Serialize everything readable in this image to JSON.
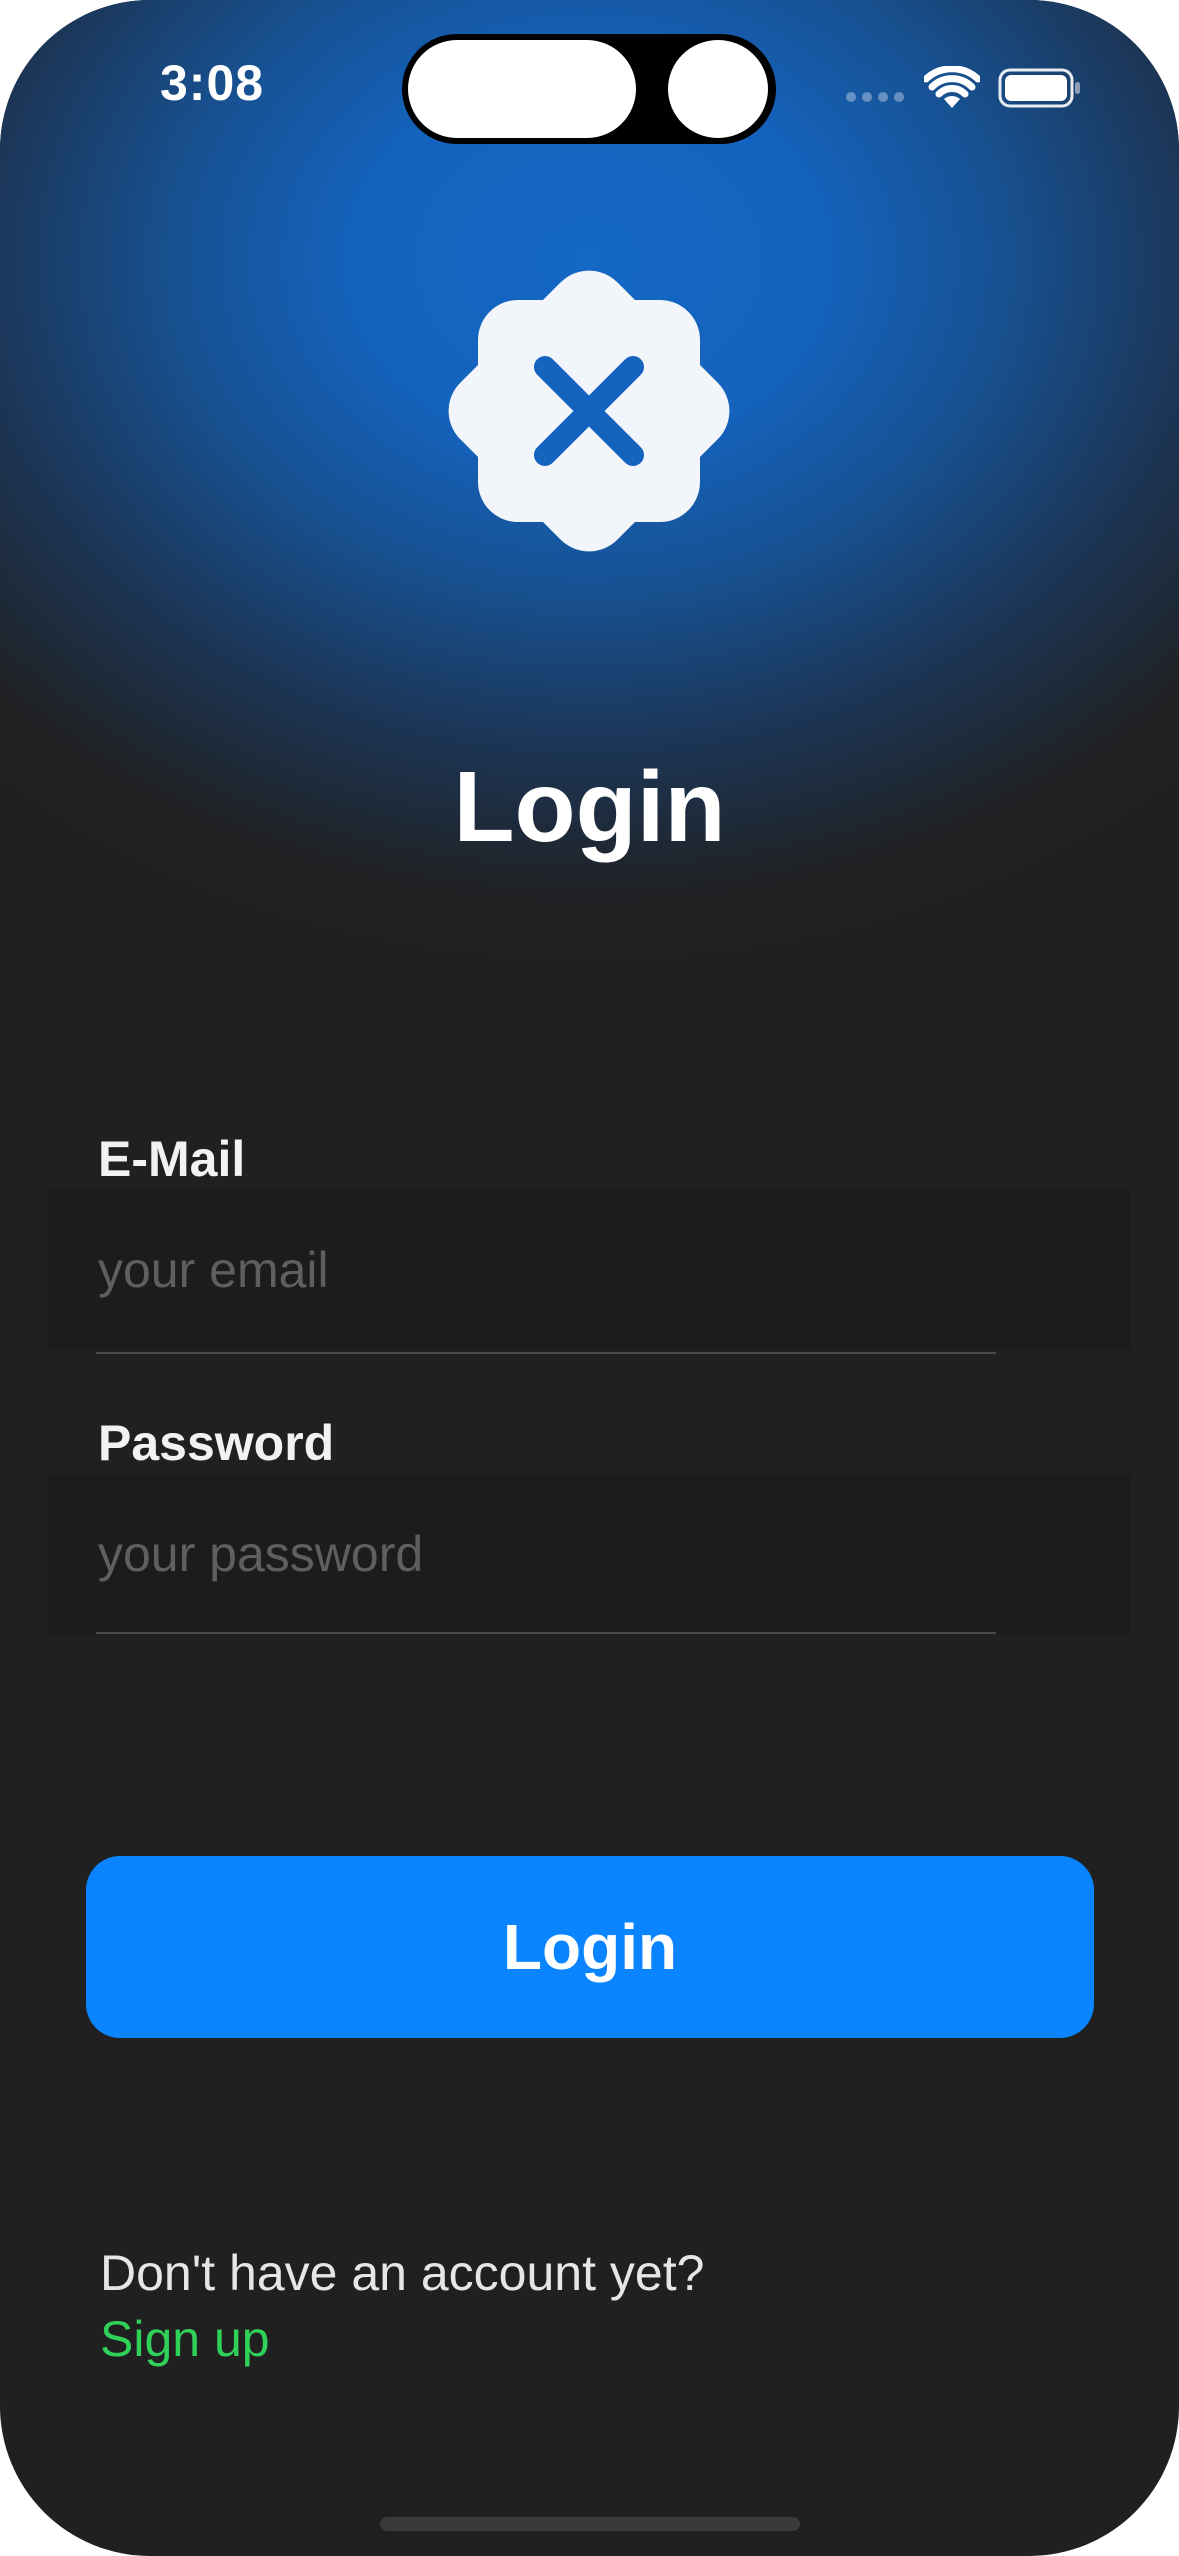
{
  "status_bar": {
    "time": "3:08",
    "icons": [
      "cellular-signal-icon",
      "wifi-icon",
      "battery-icon"
    ]
  },
  "app_icon": {
    "name": "x-badge-icon",
    "badge_color": "#f2f5f9",
    "mark_color": "#1464bf"
  },
  "title": "Login",
  "email": {
    "label": "E-Mail",
    "value": "",
    "placeholder": "your email"
  },
  "password": {
    "label": "Password",
    "value": "",
    "placeholder": "your password"
  },
  "login_button": {
    "label": "Login",
    "color": "#0a84ff"
  },
  "signup": {
    "prompt": "Don't have an account yet?",
    "link_label": "Sign up",
    "link_color": "#30d158"
  },
  "theme": {
    "background": "#202020",
    "header_glow": "#1467c4"
  }
}
